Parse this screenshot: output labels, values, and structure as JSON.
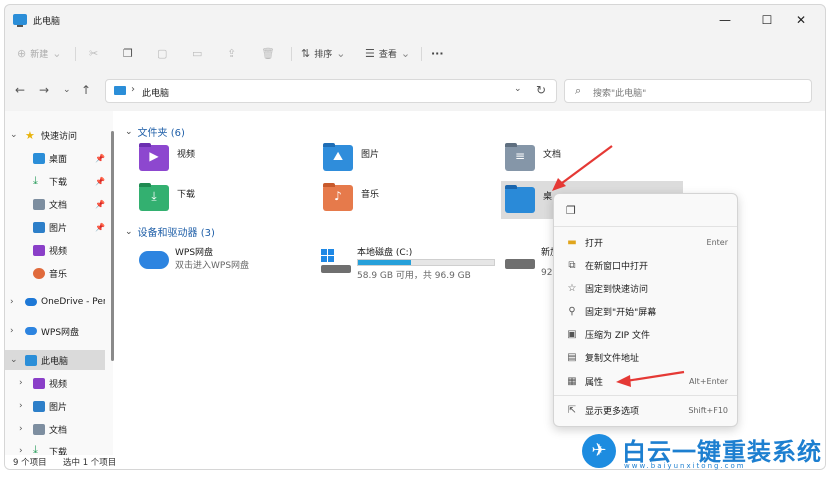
{
  "window": {
    "title": "此电脑",
    "minimize_glyph": "—",
    "maximize_glyph": "☐",
    "close_glyph": "✕"
  },
  "toolbar": {
    "new_label": "新建",
    "sort_label": "排序",
    "view_label": "查看",
    "more_label": "···"
  },
  "address": {
    "crumb": "此电脑",
    "search_placeholder": "搜索\"此电脑\""
  },
  "sidebar": {
    "items": [
      {
        "label": "快速访问",
        "icon": "star-icon"
      },
      {
        "label": "桌面",
        "icon": "desktop-icon"
      },
      {
        "label": "下载",
        "icon": "download-icon"
      },
      {
        "label": "文档",
        "icon": "document-icon"
      },
      {
        "label": "图片",
        "icon": "picture-icon"
      },
      {
        "label": "视频",
        "icon": "video-icon"
      },
      {
        "label": "音乐",
        "icon": "music-icon"
      },
      {
        "label": "OneDrive - Pers",
        "icon": "onedrive-icon"
      },
      {
        "label": "WPS网盘",
        "icon": "wps-cloud-icon"
      },
      {
        "label": "此电脑",
        "icon": "pc-icon"
      },
      {
        "label": "视频",
        "icon": "video-icon"
      },
      {
        "label": "图片",
        "icon": "picture-icon"
      },
      {
        "label": "文档",
        "icon": "document-icon"
      },
      {
        "label": "下载",
        "icon": "download-icon"
      }
    ]
  },
  "main": {
    "folders_header": "文件夹 (6)",
    "folders": [
      {
        "name": "视频",
        "icon": "video-folder-icon"
      },
      {
        "name": "图片",
        "icon": "pictures-folder-icon"
      },
      {
        "name": "文档",
        "icon": "documents-folder-icon"
      },
      {
        "name": "下载",
        "icon": "downloads-folder-icon"
      },
      {
        "name": "音乐",
        "icon": "music-folder-icon"
      },
      {
        "name": "桌",
        "icon": "desktop-folder-icon"
      }
    ],
    "devices_header": "设备和驱动器 (3)",
    "drives": [
      {
        "name": "WPS网盘",
        "sub": "双击进入WPS网盘",
        "icon": "wps-cloud-icon"
      },
      {
        "name": "本地磁盘 (C:)",
        "sub": "58.9 GB 可用，共 96.9 GB",
        "used_fraction": 0.39,
        "icon": "windows-drive-icon"
      },
      {
        "name": "新加",
        "sub": "92",
        "icon": "drive-icon"
      }
    ]
  },
  "context_menu": {
    "items": [
      {
        "label": "打开",
        "shortcut": "Enter",
        "icon": "open-icon"
      },
      {
        "label": "在新窗口中打开",
        "shortcut": "",
        "icon": "new-window-icon"
      },
      {
        "label": "固定到快速访问",
        "shortcut": "",
        "icon": "star-outline-icon"
      },
      {
        "label": "固定到\"开始\"屏幕",
        "shortcut": "",
        "icon": "pin-icon"
      },
      {
        "label": "压缩为 ZIP 文件",
        "shortcut": "",
        "icon": "zip-icon"
      },
      {
        "label": "复制文件地址",
        "shortcut": "",
        "icon": "copy-path-icon"
      },
      {
        "label": "属性",
        "shortcut": "Alt+Enter",
        "icon": "properties-icon"
      },
      {
        "label": "显示更多选项",
        "shortcut": "Shift+F10",
        "icon": "more-options-icon"
      }
    ]
  },
  "status": {
    "count": "9 个项目",
    "selected": "选中 1 个项目"
  },
  "watermark": {
    "brand": "白云一键重装系统",
    "url": "www.baiyunxitong.com"
  },
  "colors": {
    "accent": "#1f5fa8",
    "drive_bar": "#26a0da",
    "arrow": "#e53935"
  }
}
